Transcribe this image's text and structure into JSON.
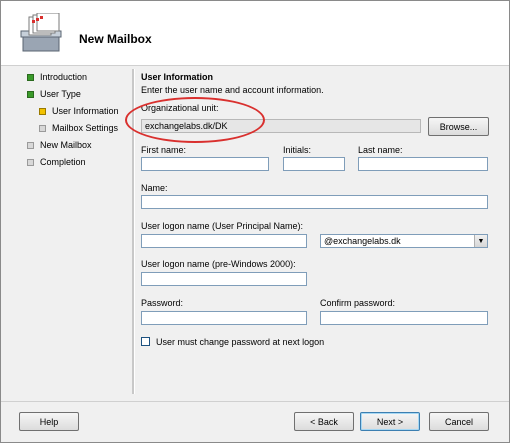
{
  "window": {
    "title": "New Mailbox"
  },
  "nav": {
    "items": [
      {
        "label": "Introduction",
        "state": "complete"
      },
      {
        "label": "User Type",
        "state": "complete"
      },
      {
        "label": "User Information",
        "state": "current"
      },
      {
        "label": "Mailbox Settings",
        "state": "pending"
      },
      {
        "label": "New Mailbox",
        "state": "pending"
      },
      {
        "label": "Completion",
        "state": "pending"
      }
    ]
  },
  "section": {
    "title": "User Information",
    "description": "Enter the user name and account information."
  },
  "form": {
    "org_unit_label": "Organizational unit:",
    "org_unit_value": "exchangelabs.dk/DK",
    "browse_label": "Browse...",
    "first_name_label": "First name:",
    "initials_label": "Initials:",
    "last_name_label": "Last name:",
    "name_label": "Name:",
    "upn_label": "User logon name (User Principal Name):",
    "upn_domain": "@exchangelabs.dk",
    "pre2000_label": "User logon name (pre-Windows 2000):",
    "password_label": "Password:",
    "confirm_password_label": "Confirm password:",
    "must_change_label": "User must change password at next logon",
    "must_change_checked": false
  },
  "footer": {
    "help_label": "Help",
    "back_label": "< Back",
    "next_label": "Next >",
    "cancel_label": "Cancel"
  },
  "colors": {
    "complete": "#3a9a2a",
    "current": "#d4a400",
    "pending": "#c8c8c8",
    "highlight": "#d9302e"
  }
}
